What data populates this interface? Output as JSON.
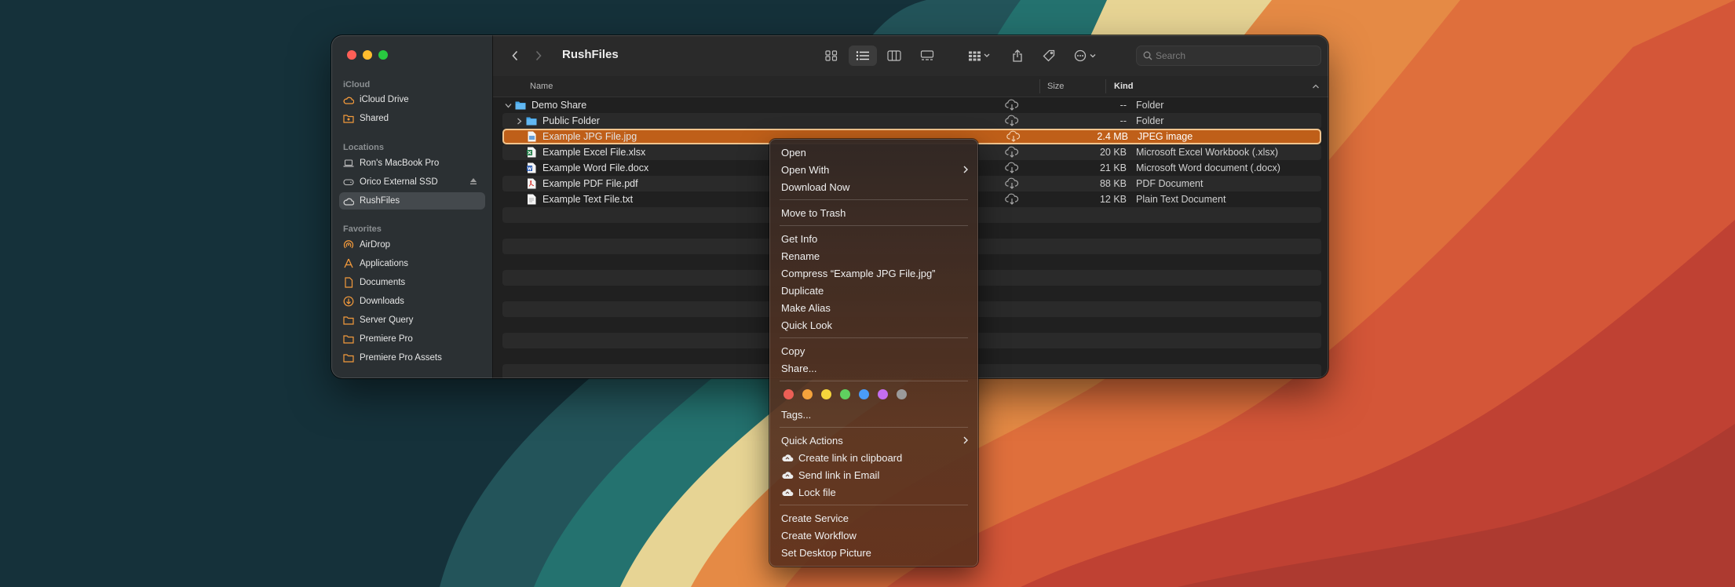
{
  "sidebar": {
    "sections": [
      {
        "title": "iCloud",
        "items": [
          {
            "label": "iCloud Drive",
            "icon": "cloud-icon"
          },
          {
            "label": "Shared",
            "icon": "shared-folder-icon"
          }
        ]
      },
      {
        "title": "Locations",
        "items": [
          {
            "label": "Ron's MacBook Pro",
            "icon": "laptop-icon"
          },
          {
            "label": "Orico External SSD",
            "icon": "external-drive-icon"
          },
          {
            "label": "RushFiles",
            "icon": "cloud-drive-icon"
          }
        ]
      },
      {
        "title": "Favorites",
        "items": [
          {
            "label": "AirDrop",
            "icon": "airdrop-icon"
          },
          {
            "label": "Applications",
            "icon": "applications-icon"
          },
          {
            "label": "Documents",
            "icon": "document-icon"
          },
          {
            "label": "Downloads",
            "icon": "download-icon"
          },
          {
            "label": "Server Query",
            "icon": "folder-icon"
          },
          {
            "label": "Premiere Pro",
            "icon": "folder-icon"
          },
          {
            "label": "Premiere Pro Assets",
            "icon": "folder-icon"
          }
        ]
      }
    ]
  },
  "toolbar": {
    "title": "RushFiles",
    "search_placeholder": "Search"
  },
  "columns": {
    "name": "Name",
    "size": "Size",
    "kind": "Kind"
  },
  "files": [
    {
      "name": "Demo Share",
      "size": "--",
      "kind": "Folder",
      "type": "folder",
      "expanded": true,
      "level": 0
    },
    {
      "name": "Public Folder",
      "size": "--",
      "kind": "Folder",
      "type": "folder",
      "expanded": false,
      "level": 1
    },
    {
      "name": "Example JPG File.jpg",
      "size": "2.4 MB",
      "kind": "JPEG image",
      "type": "jpg",
      "level": 1,
      "selected": true
    },
    {
      "name": "Example Excel File.xlsx",
      "size": "20 KB",
      "kind": "Microsoft Excel Workbook (.xlsx)",
      "type": "xlsx",
      "level": 1
    },
    {
      "name": "Example Word File.docx",
      "size": "21 KB",
      "kind": "Microsoft Word document (.docx)",
      "type": "docx",
      "level": 1
    },
    {
      "name": "Example PDF File.pdf",
      "size": "88 KB",
      "kind": "PDF Document",
      "type": "pdf",
      "level": 1
    },
    {
      "name": "Example Text File.txt",
      "size": "12 KB",
      "kind": "Plain Text Document",
      "type": "txt",
      "level": 1
    }
  ],
  "context_menu": {
    "items": [
      {
        "label": "Open"
      },
      {
        "label": "Open With",
        "submenu": true
      },
      {
        "label": "Download Now"
      },
      {
        "label": "Move to Trash"
      },
      {
        "label": "Get Info"
      },
      {
        "label": "Rename"
      },
      {
        "label": "Compress “Example JPG File.jpg”"
      },
      {
        "label": "Duplicate"
      },
      {
        "label": "Make Alias"
      },
      {
        "label": "Quick Look"
      },
      {
        "label": "Copy"
      },
      {
        "label": "Share..."
      },
      {
        "label": "Tags..."
      },
      {
        "label": "Quick Actions",
        "submenu": true
      },
      {
        "label": "Create link in clipboard",
        "icon": "rushfiles-cloud-icon"
      },
      {
        "label": "Send link in Email",
        "icon": "rushfiles-cloud-icon"
      },
      {
        "label": "Lock file",
        "icon": "rushfiles-cloud-icon"
      },
      {
        "label": "Create Service"
      },
      {
        "label": "Create Workflow"
      },
      {
        "label": "Set Desktop Picture"
      }
    ],
    "tag_colors": [
      "#ec5f55",
      "#f5a33c",
      "#f5d63c",
      "#5fd05f",
      "#4a9cf7",
      "#c46ef0",
      "#9a9a9a"
    ]
  },
  "colors": {
    "selection": "#bf5f19",
    "accent_icon": "#f39a3c",
    "folder_blue": "#45a6e8"
  }
}
